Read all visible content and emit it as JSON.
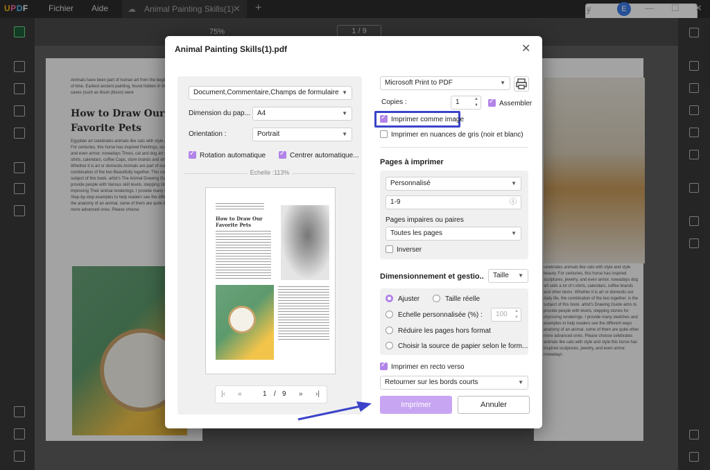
{
  "app": {
    "logo": "UPDF",
    "menu": [
      "Fichier",
      "Aide"
    ],
    "tab_title": "Animal Painting Skills(1)",
    "tab_close": "✕",
    "new_tab": "+",
    "window_count": "1",
    "avatar": "E"
  },
  "toolbar": {
    "zoom": "75%",
    "page_indicator": "1 / 9"
  },
  "background_doc": {
    "left_intro": "Animals have been part of human art from the beginning of time. Earliest ancient painting, found hidden in the caves (such as bison (bison) were",
    "left_title": "How to Draw Our Favorite Pets",
    "left_body": "Egyptian art celebrates animals like cats with style and style beauty. For centuries, this horse has inspired Paintings, sculptures, jewelry, and even armor. nowadays Times, cat and dog art sells a lot of t-shirts, calendars, coffee Caps, store brands and other items. Whether it is art or domestic Animals are part of our daily life, the combination of the two Beautifully together. This combination is the subject of this book. artist's The Animal Drawing Guide aims to provide people with Various skill levels, stepping stones for improving Their animal renderings. I provide many sketches and Step-by-step examples to help readers see the different ways Build the anatomy of an animal. some of them are quite Basic and other more advanced ones. Please choose",
    "right_body": "celebrates animals like cats with style and style beauty. For centuries, this horse has inspired sculptures, jewelry, and even armor. nowadays dog art sells a lot of t-shirts, calendars, coffee brands and other items. Whether it is art or domestic our daily life, the combination of the two together. is the subject of this book. artist's Drawing Guide aims to provide people with levels, stepping stones for improving renderings. I provide many sketches and examples to help readers see the different ways anatomy of an animal. some of them are quite other more advanced ones. Please choose celebrates animals like cats with style and style this horse has inspired sculptures, jewelry, and even armor. nowadays"
  },
  "dialog": {
    "title": "Animal Painting Skills(1).pdf",
    "close": "✕",
    "left": {
      "content_select": "Document,Commentaire,Champs de formulaire",
      "size_label": "Dimension du pap...",
      "size_value": "A4",
      "orientation_label": "Orientation :",
      "orientation_value": "Portrait",
      "auto_rotate": "Rotation automatique",
      "auto_center": "Centrer automatique...",
      "scale": "Echelle :113%",
      "preview_title": "How to Draw Our Favorite Pets",
      "pager_current": "1",
      "pager_sep": "/",
      "pager_total": "9"
    },
    "right": {
      "printer": "Microsoft Print to PDF",
      "copies_label": "Copies :",
      "copies_value": "1",
      "collate": "Assembler",
      "print_as_image": "Imprimer comme image",
      "grayscale": "Imprimer en nuances de gris (noir et blanc)",
      "pages_title": "Pages à imprimer",
      "pages_mode": "Personnalisé",
      "pages_range": "1-9",
      "odd_even_label": "Pages impaires ou paires",
      "odd_even_value": "Toutes les pages",
      "reverse": "Inverser",
      "sizing_title": "Dimensionnement et gestio..",
      "sizing_mode": "Taille",
      "fit": "Ajuster",
      "actual_size": "Taille réelle",
      "custom_scale": "Echelle personnalisée (%) :",
      "custom_scale_value": "100",
      "shrink": "Réduire les pages hors format",
      "paper_source": "Choisir la source de papier selon le form...",
      "duplex": "Imprimer en recto verso",
      "duplex_mode": "Retourner sur les bords courts",
      "print_button": "Imprimer",
      "cancel_button": "Annuler"
    }
  },
  "colors": {
    "accent": "#b284e8",
    "print_button": "#c7a5f2",
    "highlight_box": "#3a43c9",
    "annotation_arrow": "#3a43c9"
  }
}
